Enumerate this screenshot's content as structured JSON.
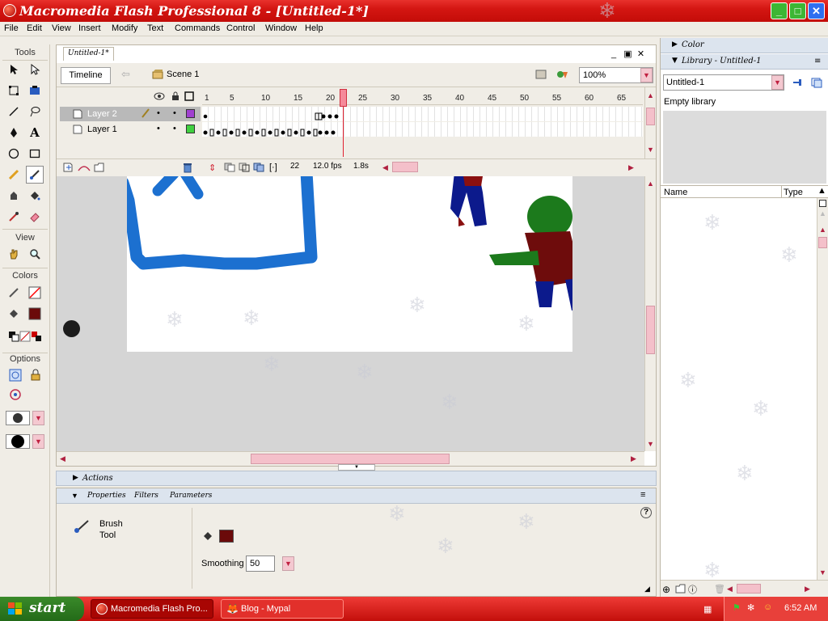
{
  "window": {
    "title": "Macromedia Flash Professional 8 - [Untitled-1*]"
  },
  "menu": [
    "File",
    "Edit",
    "View",
    "Insert",
    "Modify",
    "Text",
    "Commands",
    "Control",
    "Window",
    "Help"
  ],
  "tools": {
    "header": "Tools",
    "view_label": "View",
    "colors_label": "Colors",
    "options_label": "Options",
    "stroke_color": "#ff0000",
    "fill_color": "#6b0a0a"
  },
  "document": {
    "tab": "Untitled-1*",
    "timeline_button": "Timeline",
    "scene": "Scene 1",
    "zoom": "100%",
    "layers": [
      {
        "name": "Layer 2",
        "color": "#a040d0",
        "active": true
      },
      {
        "name": "Layer 1",
        "color": "#40d040",
        "active": false
      }
    ],
    "frame_numbers": [
      "1",
      "5",
      "10",
      "15",
      "20",
      "25",
      "30",
      "35",
      "40",
      "45",
      "50",
      "55",
      "60",
      "65"
    ],
    "status": {
      "current_frame": "22",
      "fps": "12.0 fps",
      "time": "1.8s"
    }
  },
  "actions_panel": {
    "title": "Actions"
  },
  "properties_panel": {
    "tabs": [
      "Properties",
      "Filters",
      "Parameters"
    ],
    "tool_name": "Brush\nTool",
    "smoothing_label": "Smoothing",
    "smoothing_value": "50"
  },
  "right_panel": {
    "color_title": "Color",
    "library_title": "Library - Untitled-1",
    "library_doc": "Untitled-1",
    "empty_text": "Empty library",
    "col_name": "Name",
    "col_type": "Type"
  },
  "taskbar": {
    "start": "start",
    "tasks": [
      "Macromedia Flash Pro...",
      "Blog - Mypal"
    ],
    "clock": "6:52 AM"
  }
}
